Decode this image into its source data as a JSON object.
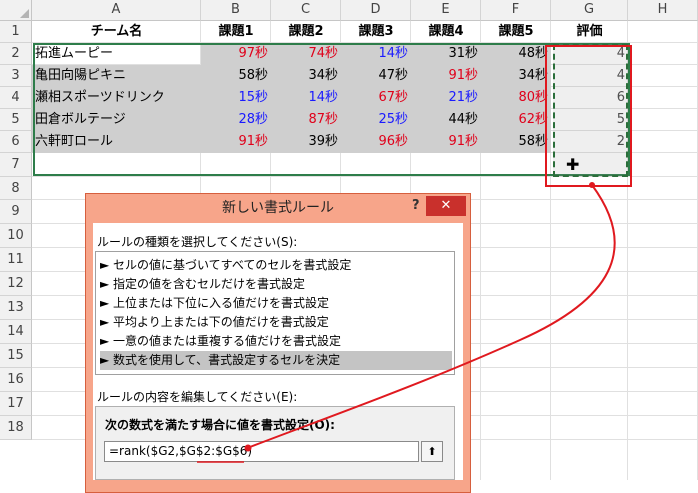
{
  "columns": [
    "A",
    "B",
    "C",
    "D",
    "E",
    "F",
    "G",
    "H"
  ],
  "rows": [
    "1",
    "2",
    "3",
    "4",
    "5",
    "6",
    "7",
    "8",
    "9",
    "10",
    "11",
    "12",
    "13",
    "14",
    "15",
    "16",
    "17",
    "18"
  ],
  "headers": [
    "チーム名",
    "課題1",
    "課題2",
    "課題3",
    "課題4",
    "課題5",
    "評価"
  ],
  "data": [
    {
      "name": "拓進ムーピー",
      "vals": [
        "97秒",
        "74秒",
        "14秒",
        "31秒",
        "48秒"
      ],
      "colors": [
        "red",
        "red",
        "blue",
        "black",
        "black"
      ],
      "rank": "4"
    },
    {
      "name": "亀田向陽ピキニ",
      "vals": [
        "58秒",
        "34秒",
        "47秒",
        "91秒",
        "34秒"
      ],
      "colors": [
        "black",
        "black",
        "black",
        "red",
        "black"
      ],
      "rank": "4"
    },
    {
      "name": "瀬相スポーツドリンク",
      "vals": [
        "15秒",
        "14秒",
        "67秒",
        "21秒",
        "80秒"
      ],
      "colors": [
        "blue",
        "blue",
        "red",
        "blue",
        "red"
      ],
      "rank": "6"
    },
    {
      "name": "田倉ボルテージ",
      "vals": [
        "28秒",
        "87秒",
        "25秒",
        "44秒",
        "62秒"
      ],
      "colors": [
        "blue",
        "red",
        "blue",
        "black",
        "red"
      ],
      "rank": "5"
    },
    {
      "name": "六軒町ロール",
      "vals": [
        "91秒",
        "39秒",
        "96秒",
        "91秒",
        "58秒"
      ],
      "colors": [
        "red",
        "black",
        "red",
        "red",
        "black"
      ],
      "rank": "2"
    }
  ],
  "dialog": {
    "title": "新しい書式ルール",
    "help": "?",
    "close": "✕",
    "rule_type_label": "ルールの種類を選択してください(S):",
    "rule_types": [
      "► セルの値に基づいてすべてのセルを書式設定",
      "► 指定の値を含むセルだけを書式設定",
      "► 上位または下位に入る値だけを書式設定",
      "► 平均より上または下の値だけを書式設定",
      "► 一意の値または重複する値だけを書式設定",
      "► 数式を使用して、書式設定するセルを決定"
    ],
    "edit_label": "ルールの内容を編集してください(E):",
    "formula_label": "次の数式を満たす場合に値を書式設定(O):",
    "formula": "=rank($G2,$G$2:$G$6)",
    "formula_btn": "⬆"
  },
  "colors": {
    "accent_red": "#e0191f",
    "selection_green": "#2e7d4a",
    "dialog_frame": "#f7a58a"
  }
}
